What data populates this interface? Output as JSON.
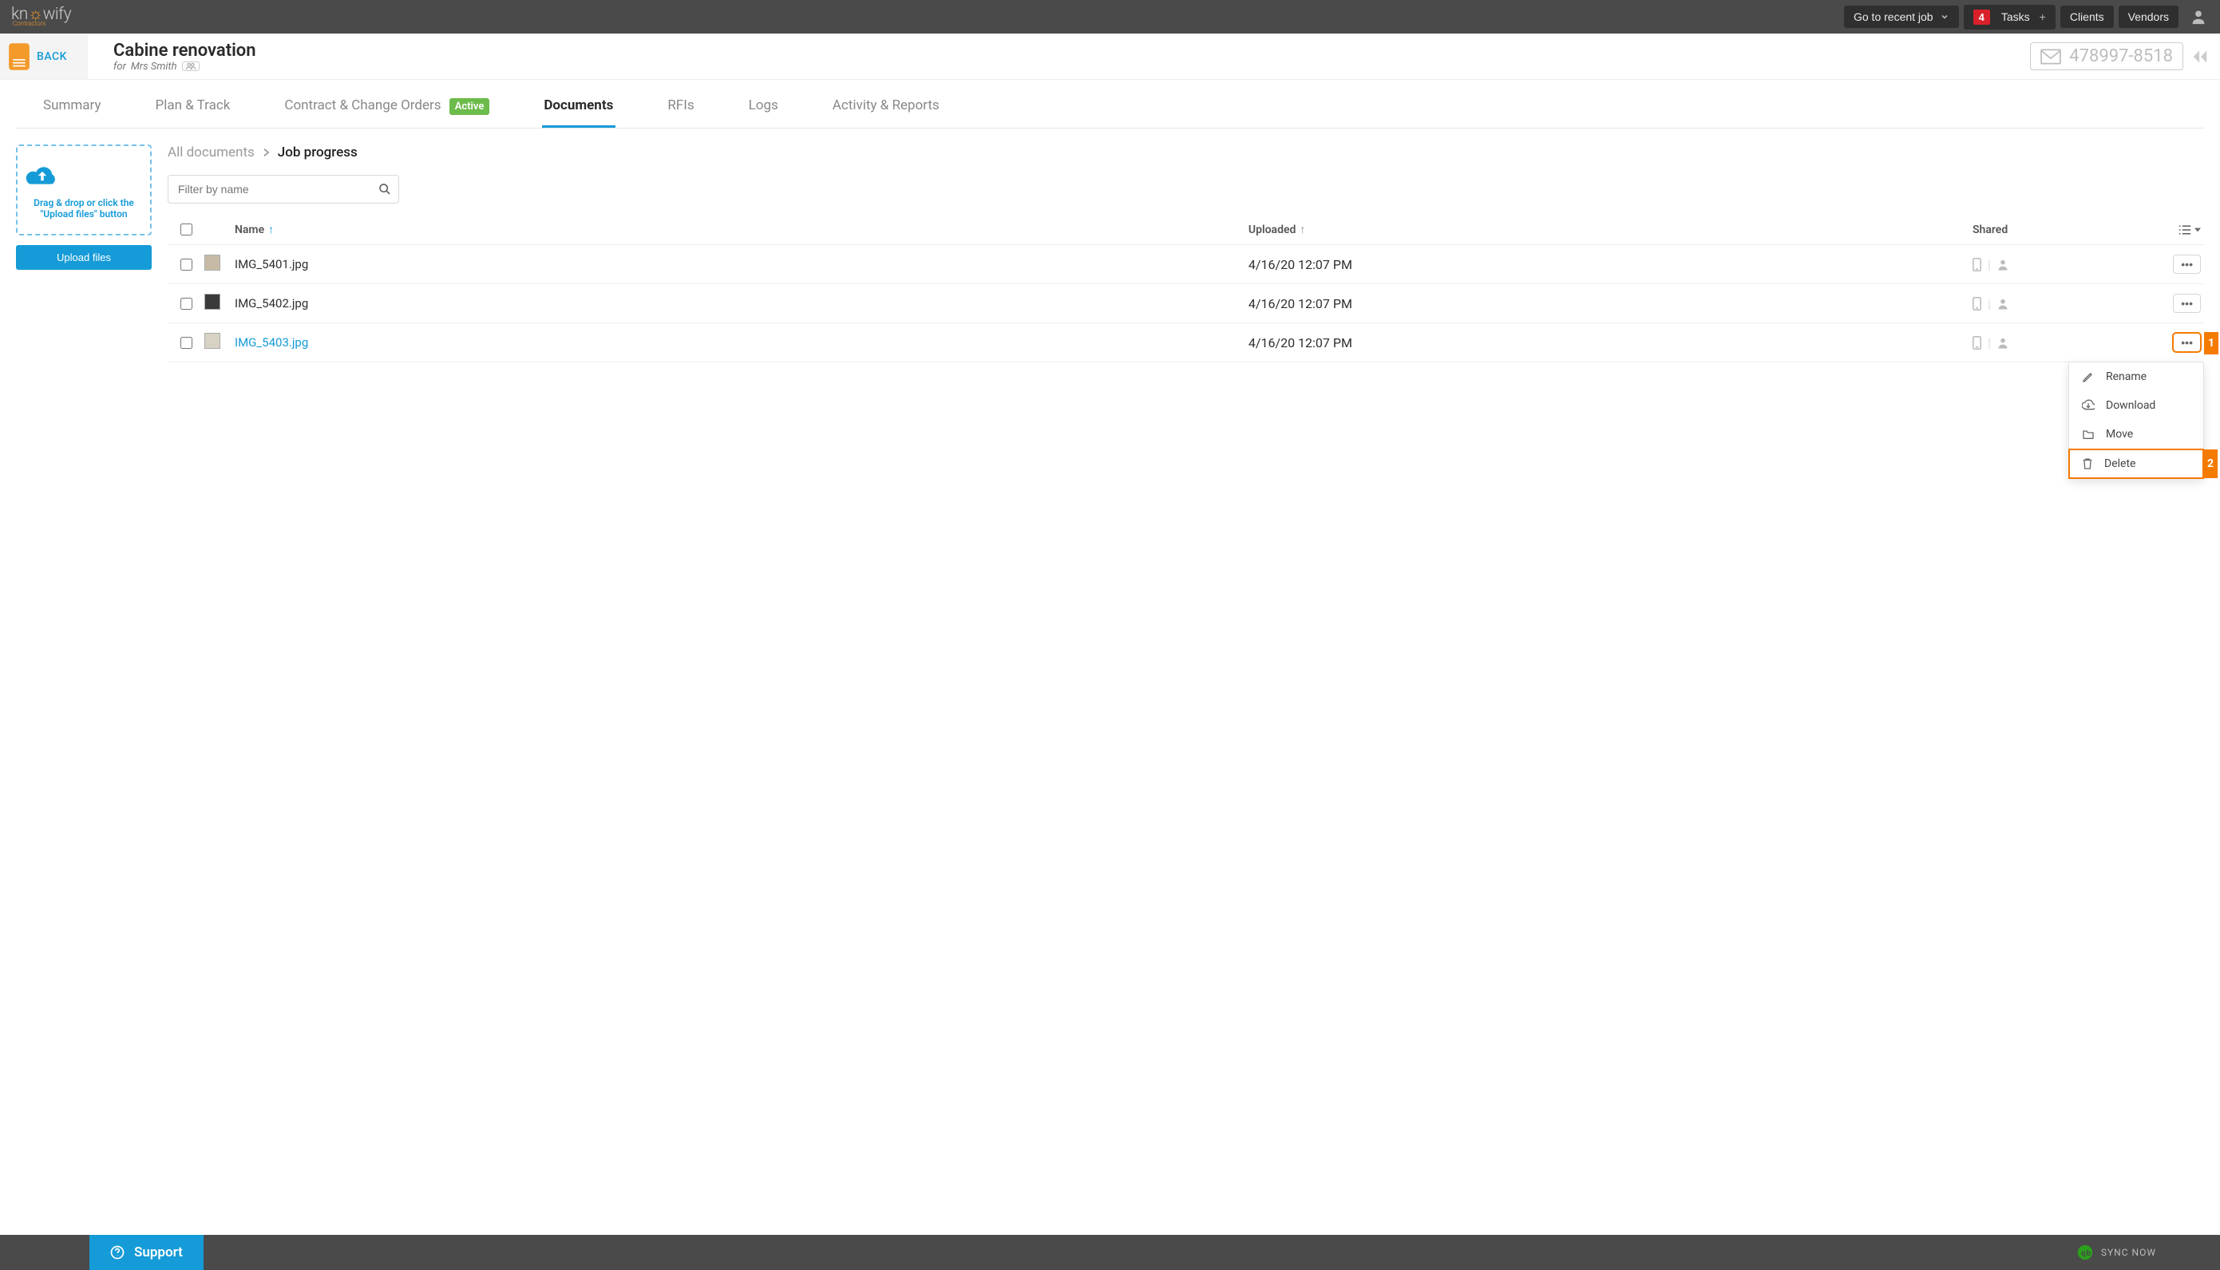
{
  "topbar": {
    "recent_job_label": "Go to recent job",
    "tasks_badge": "4",
    "tasks_label": "Tasks",
    "tasks_plus": "+",
    "clients_label": "Clients",
    "vendors_label": "Vendors"
  },
  "logo": {
    "brand": "knowify",
    "sub": "Contractors"
  },
  "back": {
    "label": "BACK"
  },
  "job": {
    "title": "Cabine renovation",
    "for_prefix": "for",
    "client": "Mrs Smith",
    "email_ref": "478997-8518"
  },
  "tabs": [
    {
      "label": "Summary"
    },
    {
      "label": "Plan & Track"
    },
    {
      "label": "Contract & Change Orders",
      "badge": "Active"
    },
    {
      "label": "Documents",
      "active": true
    },
    {
      "label": "RFIs"
    },
    {
      "label": "Logs"
    },
    {
      "label": "Activity & Reports"
    }
  ],
  "breadcrumb": {
    "root": "All documents",
    "current": "Job progress"
  },
  "filter": {
    "placeholder": "Filter by name"
  },
  "uploader": {
    "dropzone_text": "Drag & drop or click the \"Upload files\" button",
    "button_label": "Upload files"
  },
  "table": {
    "headers": {
      "name": "Name",
      "uploaded": "Uploaded",
      "shared": "Shared"
    },
    "rows": [
      {
        "name": "IMG_5401.jpg",
        "uploaded": "4/16/20 12:07 PM"
      },
      {
        "name": "IMG_5402.jpg",
        "uploaded": "4/16/20 12:07 PM"
      },
      {
        "name": "IMG_5403.jpg",
        "uploaded": "4/16/20 12:07 PM"
      }
    ]
  },
  "ctx": {
    "rename": "Rename",
    "download": "Download",
    "move": "Move",
    "delete": "Delete"
  },
  "callouts": {
    "one": "1",
    "two": "2"
  },
  "footer": {
    "support": "Support",
    "sync": "SYNC NOW"
  }
}
